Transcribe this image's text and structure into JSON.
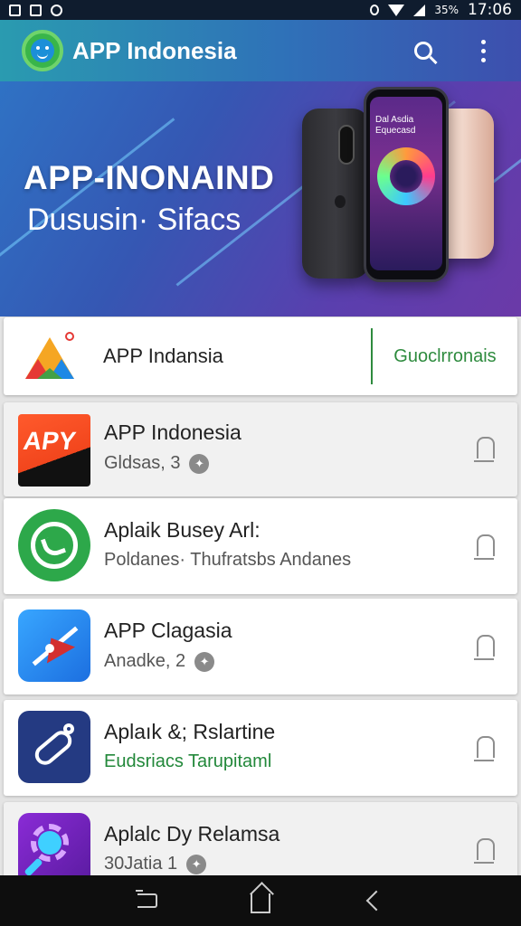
{
  "status_bar": {
    "battery": "35%",
    "time": "17:06"
  },
  "app_bar": {
    "title": "APP Indonesia"
  },
  "banner": {
    "headline": "APP-INONAIND",
    "subheadline": "Dususin· Sifacs",
    "phone_screen_text": "Dal Asdia\nEquecasd"
  },
  "top_card": {
    "name": "APP Indansia",
    "action_label": "Guoclrronais"
  },
  "app_list": [
    {
      "name": "APP Indonesia",
      "subtitle": "Gldsas, 3",
      "icon": "apy-icon",
      "icon_text": "APY"
    },
    {
      "name": "Aplaik Busey Arl:",
      "subtitle": "Poldanes· Thufratsbs Andanes",
      "icon": "phone-chat-icon"
    },
    {
      "name": "APP Clagasia",
      "subtitle": "Anadke, 2",
      "icon": "compass-icon"
    },
    {
      "name": "Aplaık &; Rslartine",
      "subtitle": "Eudsriacs  Tarupitaml",
      "icon": "link-icon"
    },
    {
      "name": "Aplalc Dy Relamsa",
      "subtitle": "30Jatia 1",
      "icon": "magnifier-gear-icon"
    }
  ]
}
